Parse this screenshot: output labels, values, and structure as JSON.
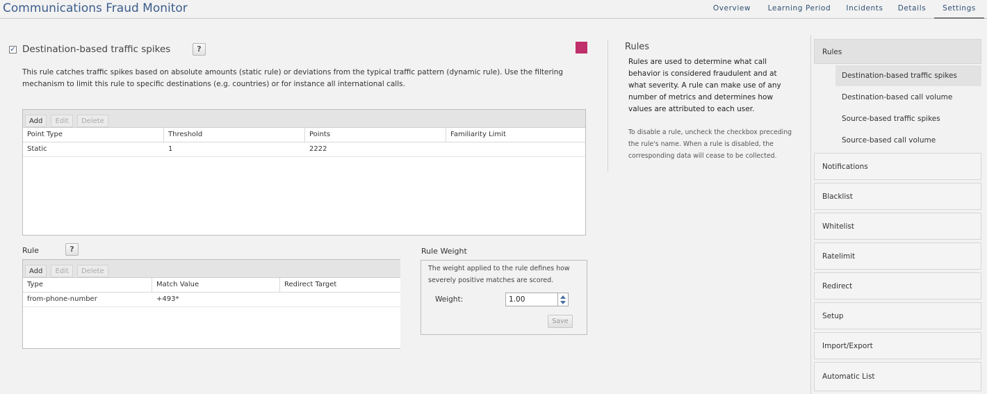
{
  "app": {
    "title": "Communications Fraud Monitor"
  },
  "nav": {
    "tabs": [
      "Overview",
      "Learning Period",
      "Incidents",
      "Details",
      "Settings"
    ],
    "active": "Settings"
  },
  "rule": {
    "enabled": true,
    "title": "Destination-based traffic spikes",
    "help_label": "?",
    "color": "#c0306a",
    "description": "This rule catches traffic spikes based on absolute amounts (static rule) or deviations from the typical traffic pattern (dynamic rule). Use the filtering mechanism to limit this rule to specific destinations (e.g. countries) or for instance all international calls."
  },
  "points_grid": {
    "toolbar": {
      "add": "Add",
      "edit": "Edit",
      "delete": "Delete"
    },
    "columns": [
      "Point Type",
      "Threshold",
      "Points",
      "Familiarity Limit"
    ],
    "rows": [
      [
        "Static",
        "1",
        "2222",
        ""
      ]
    ]
  },
  "filter_grid": {
    "label": "Rule",
    "help_label": "?",
    "toolbar": {
      "add": "Add",
      "edit": "Edit",
      "delete": "Delete"
    },
    "columns": [
      "Type",
      "Match Value",
      "Redirect Target"
    ],
    "rows": [
      [
        "from-phone-number",
        "+493*",
        ""
      ]
    ]
  },
  "weight": {
    "label": "Rule Weight",
    "description": "The weight applied to the rule defines how severely positive matches are scored.",
    "field_label": "Weight:",
    "value": "1.00",
    "save": "Save"
  },
  "help": {
    "title": "Rules",
    "main": "Rules are used to determine what call behavior is considered fraudulent and at what severity. A rule can make use of any number of metrics and determines how values are attributed to each user.",
    "note": "To disable a rule, uncheck the checkbox preceding the rule's name. When a rule is disabled, the corresponding data will cease to be collected."
  },
  "sidebar": {
    "sections": {
      "rules": "Rules",
      "notifications": "Notifications",
      "blacklist": "Blacklist",
      "whitelist": "Whitelist",
      "ratelimit": "Ratelimit",
      "redirect": "Redirect",
      "setup": "Setup",
      "import_export": "Import/Export",
      "automatic_list": "Automatic List"
    },
    "rules_items": [
      "Destination-based traffic spikes",
      "Destination-based call volume",
      "Source-based traffic spikes",
      "Source-based call volume"
    ],
    "active_rule": "Destination-based traffic spikes"
  }
}
